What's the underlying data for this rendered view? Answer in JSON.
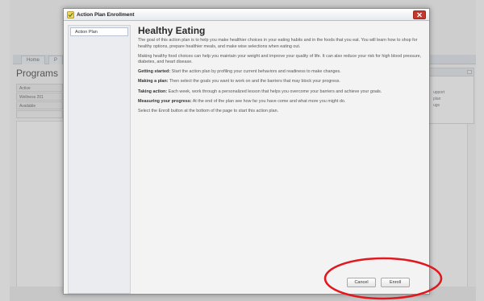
{
  "background": {
    "tabs": [
      "Home",
      "P"
    ],
    "page_title": "Programs",
    "sidebar_items": [
      "Active",
      "Wellness 201",
      "Available",
      ""
    ],
    "right_panel_links": [
      "upport",
      "plan",
      "ugs"
    ]
  },
  "dialog": {
    "title": "Action Plan Enrollment",
    "nav_item": "Action Plan",
    "heading": "Healthy Eating",
    "paragraphs": [
      {
        "lead": "",
        "text": "The goal of this action plan is to help you make healthier choices in your eating habits and in the foods that you eat. You will learn how to shop for healthy options, prepare healthier meals, and make wise selections when eating out."
      },
      {
        "lead": "",
        "text": "Making healthy food choices can help you maintain your weight and improve your quality of life. It can also reduce your risk for high blood pressure, diabetes, and heart disease."
      },
      {
        "lead": "Getting started:",
        "text": " Start the action plan by profiling your current behaviors and readiness to make changes."
      },
      {
        "lead": "Making a plan:",
        "text": " Then select the goals you want to work on and the barriers that may block your progress."
      },
      {
        "lead": "Taking action:",
        "text": " Each week, work through a personalized lesson that helps you overcome your barriers and achieve your goals."
      },
      {
        "lead": "Measuring your progress:",
        "text": " At the end of the plan see how far you have come and what more you might do."
      },
      {
        "lead": "",
        "text": "Select the Enroll button at the bottom of the page to start this action plan."
      }
    ],
    "cancel_label": "Cancel",
    "enroll_label": "Enroll"
  },
  "colors": {
    "close_button": "#c8362b",
    "annotation": "#e0191f"
  },
  "icons": {
    "title": "checklist-icon",
    "close": "close-icon"
  }
}
